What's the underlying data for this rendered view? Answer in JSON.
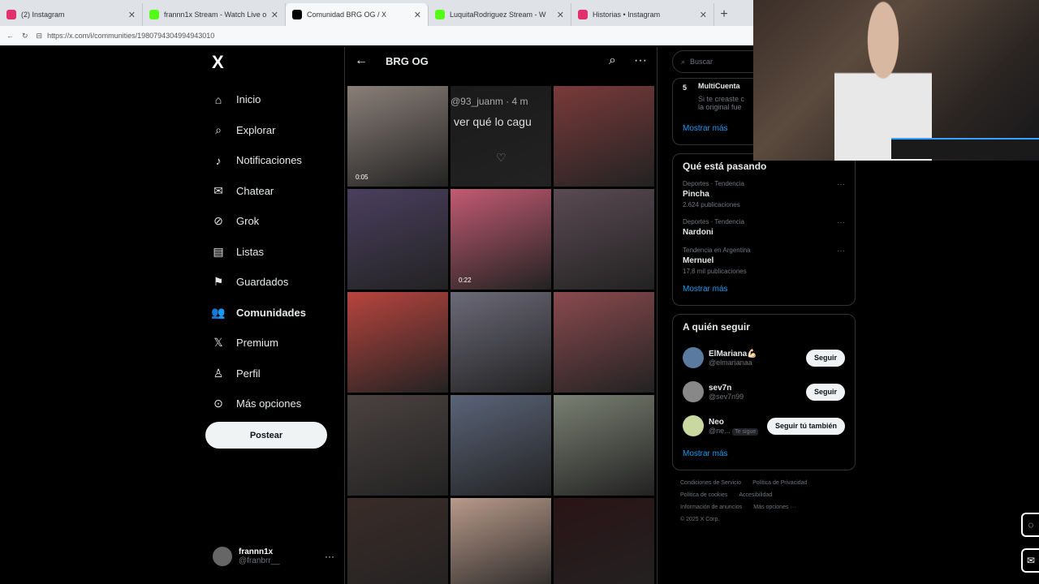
{
  "browser": {
    "tabs": [
      {
        "title": "(2) Instagram",
        "color": "#e1306c"
      },
      {
        "title": "frannn1x Stream - Watch Live on",
        "color": "#53fc18"
      },
      {
        "title": "Comunidad BRG OG / X",
        "color": "#000000",
        "active": true
      },
      {
        "title": "LuquitaRodriguez Stream - W",
        "color": "#53fc18"
      },
      {
        "title": "Historias • Instagram",
        "color": "#e1306c"
      }
    ],
    "url": "https://x.com/i/communities/1980794304994943010"
  },
  "sidebar": {
    "logo": "X",
    "items": [
      {
        "label": "Inicio",
        "icon": "home-icon",
        "glyph": "⌂"
      },
      {
        "label": "Explorar",
        "icon": "search-icon",
        "glyph": "⌕"
      },
      {
        "label": "Notificaciones",
        "icon": "bell-icon",
        "glyph": "♪"
      },
      {
        "label": "Chatear",
        "icon": "mail-icon",
        "glyph": "✉"
      },
      {
        "label": "Grok",
        "icon": "grok-icon",
        "glyph": "⊘"
      },
      {
        "label": "Listas",
        "icon": "list-icon",
        "glyph": "▤"
      },
      {
        "label": "Guardados",
        "icon": "bookmark-icon",
        "glyph": "⚑"
      },
      {
        "label": "Comunidades",
        "icon": "people-icon",
        "glyph": "👥",
        "bold": true
      },
      {
        "label": "Premium",
        "icon": "x-icon",
        "glyph": "𝕏"
      },
      {
        "label": "Perfil",
        "icon": "person-icon",
        "glyph": "♙"
      },
      {
        "label": "Más opciones",
        "icon": "more-circle-icon",
        "glyph": "⊙"
      }
    ],
    "post_label": "Postear",
    "profile": {
      "name": "frannn1x",
      "handle": "@franbrr__"
    }
  },
  "center": {
    "title": "BRG OG",
    "grid": [
      {
        "color": "#8a7f78",
        "dur": "0:05"
      },
      {
        "color": "#1a1a1a",
        "dur": "",
        "overlay": "@93_juanm · 4 m",
        "overlay2": "ver qué lo cagu"
      },
      {
        "color": "#7a3a3a",
        "dur": ""
      },
      {
        "color": "#4a3f5e",
        "dur": ""
      },
      {
        "color": "#c25a72",
        "dur": "0:22"
      },
      {
        "color": "#5a4a52",
        "dur": ""
      },
      {
        "color": "#b8443e",
        "dur": ""
      },
      {
        "color": "#6b6a78",
        "dur": ""
      },
      {
        "color": "#8a4a4e",
        "dur": ""
      },
      {
        "color": "#4a4240",
        "dur": ""
      },
      {
        "color": "#5a6478",
        "dur": ""
      },
      {
        "color": "#7a8072",
        "dur": ""
      },
      {
        "color": "#3a2c28",
        "dur": ""
      },
      {
        "color": "#b89a8a",
        "dur": ""
      },
      {
        "color": "#2a1416",
        "dur": ""
      }
    ]
  },
  "right": {
    "search_placeholder": "Buscar",
    "top_snippet": {
      "num": "5",
      "title": "MultiCuenta",
      "text1": "Si te creaste c",
      "text2": "la original fue"
    },
    "more": "Mostrar más",
    "trends_title": "Qué está pasando",
    "trends": [
      {
        "cat": "Deportes · Tendencia",
        "name": "Pincha",
        "count": "2.624 publicaciones"
      },
      {
        "cat": "Deportes · Tendencia",
        "name": "Nardoni",
        "count": ""
      },
      {
        "cat": "Tendencia en Argentina",
        "name": "Mernuel",
        "count": "17,8 mil publicaciones"
      }
    ],
    "follow_title": "A quién seguir",
    "follows": [
      {
        "name": "ElMariana💪🏻",
        "handle": "@elmarianaa",
        "btn": "Seguir",
        "color": "#5a7aa0"
      },
      {
        "name": "sev7n",
        "handle": "@sev7n99",
        "btn": "Seguir",
        "color": "#888888"
      },
      {
        "name": "Neo",
        "handle": "@ne...",
        "badge": "Te sigue",
        "btn": "Seguir tú también",
        "color": "#c8d8a0"
      }
    ],
    "footer": [
      "Condiciones de Servicio",
      "Política de Privacidad",
      "Política de cookies",
      "Accesibilidad",
      "Información de anuncios",
      "Más opciones ···",
      "© 2025 X Corp."
    ]
  }
}
